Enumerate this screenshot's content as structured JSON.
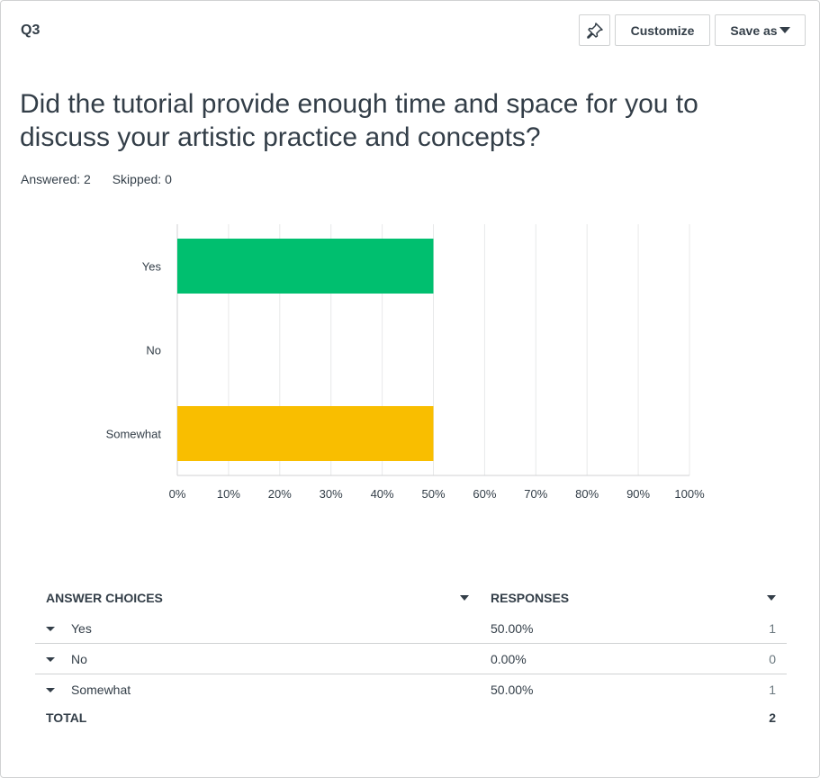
{
  "question_number": "Q3",
  "toolbar": {
    "customize_label": "Customize",
    "save_label": "Save as"
  },
  "question_text": "Did the tutorial provide enough time and space for you to discuss your artistic practice and concepts?",
  "stats": {
    "answered": "Answered: 2",
    "skipped": "Skipped: 0"
  },
  "chart_data": {
    "type": "bar",
    "orientation": "horizontal",
    "categories": [
      "Yes",
      "No",
      "Somewhat"
    ],
    "values": [
      50,
      0,
      50
    ],
    "colors": [
      "#00bf6f",
      "#00bf6f",
      "#f9be00"
    ],
    "xlim": [
      0,
      100
    ],
    "x_ticks": [
      "0%",
      "10%",
      "20%",
      "30%",
      "40%",
      "50%",
      "60%",
      "70%",
      "80%",
      "90%",
      "100%"
    ],
    "grid": true
  },
  "table": {
    "headers": {
      "choices": "ANSWER CHOICES",
      "responses": "RESPONSES"
    },
    "rows": [
      {
        "choice": "Yes",
        "percent": "50.00%",
        "count": "1"
      },
      {
        "choice": "No",
        "percent": "0.00%",
        "count": "0"
      },
      {
        "choice": "Somewhat",
        "percent": "50.00%",
        "count": "1"
      }
    ],
    "total": {
      "label": "TOTAL",
      "count": "2"
    }
  }
}
